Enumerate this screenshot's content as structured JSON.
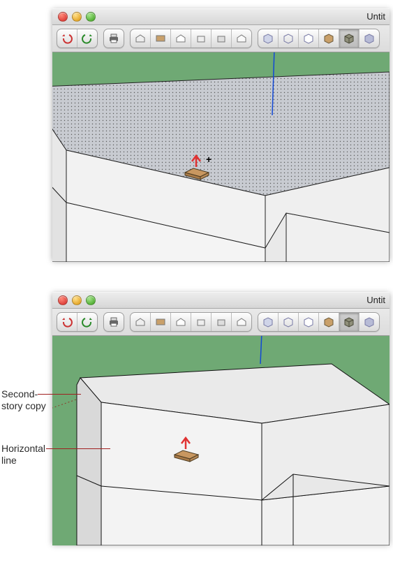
{
  "window": {
    "title_truncated": "Untit"
  },
  "toolbar": {
    "undo_tip": "Undo",
    "redo_tip": "Redo",
    "print_tip": "Print",
    "view_iso_tip": "Iso",
    "view_front_tip": "Front",
    "view_top_tip": "Top",
    "view_right_tip": "Right",
    "view_back_tip": "Back",
    "view_left_tip": "Left",
    "style_wire_tip": "Wireframe",
    "style_hidden_tip": "Hidden Line",
    "style_shaded_tip": "Shaded",
    "style_shaded_tex_tip": "Shaded With Textures",
    "style_mono_tip": "Monochrome",
    "style_xray_tip": "X-Ray"
  },
  "annotations": {
    "second_story_line1": "Second-",
    "second_story_line2": "story copy",
    "horizontal_line1": "Horizontal",
    "horizontal_line2": "line"
  },
  "chart_data": {
    "type": "table",
    "title": "SketchUp Push/Pull tool illustration",
    "panels": [
      {
        "index": 1,
        "description": "Top face of a box selected (dotted fill); Push/Pull cursor shown; blue vertical inference line visible"
      },
      {
        "index": 2,
        "description": "Box extruded upward into a second storey; horizontal seam line visible where the original top was; Push/Pull cursor on front face"
      }
    ],
    "callouts": [
      {
        "label": "Second-story copy",
        "points_to": "upper portion of extruded box in panel 2"
      },
      {
        "label": "Horizontal line",
        "points_to": "seam between original storey and copied storey in panel 2"
      }
    ]
  }
}
